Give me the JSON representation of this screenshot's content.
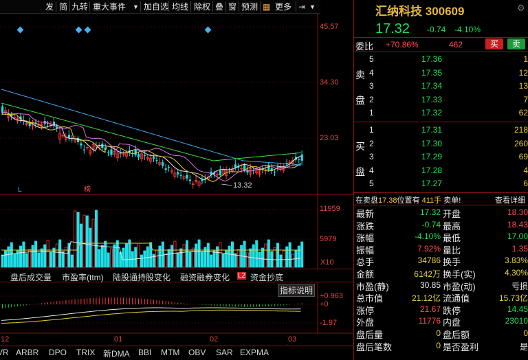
{
  "toolbar": {
    "items": [
      "发",
      "简",
      "九转",
      "重大事件",
      "▼",
      "加自选",
      "均线",
      "除权",
      "叠",
      "窗",
      "预测",
      "更多",
      "▼"
    ]
  },
  "axis": {
    "price": [
      "45.57",
      "34.30",
      "23.03"
    ],
    "volume": [
      "11959",
      "5979",
      "X10"
    ],
    "indicator": [
      "+0.963",
      "+0",
      "-1.97"
    ],
    "dates": [
      "12",
      "01",
      "02",
      "03"
    ]
  },
  "chart_marks": {
    "low_label": "13.32",
    "l1": "L",
    "l2": "榜"
  },
  "tabs": [
    "盘后成交量",
    "市盈率(ttm)",
    "陆股通持股变化",
    "融资融券变化",
    "资金抄底"
  ],
  "tab_l2": "L2",
  "indicator_button": "指标说明",
  "bottom_tabs": [
    "VR",
    "ARBR",
    "DPO",
    "TRIX",
    "新DMA",
    "BBI",
    "MTM",
    "OBV",
    "SAR",
    "EXPMA"
  ],
  "stock": {
    "name": "汇纳科技",
    "code": "300609",
    "price": "17.32",
    "change": "-0.74",
    "change_pct": "-4.10%"
  },
  "weibi": {
    "label": "委比",
    "pct": "+70.86%",
    "diff": "462",
    "sell_btn": "买",
    "buy_btn": "卖"
  },
  "sell_side_label": [
    "卖",
    "盘"
  ],
  "buy_side_label": [
    "买",
    "盘"
  ],
  "asks": [
    {
      "lv": "5",
      "price": "17.36",
      "vol": "1"
    },
    {
      "lv": "4",
      "price": "17.35",
      "vol": "12"
    },
    {
      "lv": "3",
      "price": "17.34",
      "vol": "13"
    },
    {
      "lv": "2",
      "price": "17.33",
      "vol": "7"
    },
    {
      "lv": "1",
      "price": "17.32",
      "vol": "62"
    }
  ],
  "bids": [
    {
      "lv": "1",
      "price": "17.31",
      "vol": "218"
    },
    {
      "lv": "2",
      "price": "17.30",
      "vol": "260"
    },
    {
      "lv": "3",
      "price": "17.29",
      "vol": "69"
    },
    {
      "lv": "4",
      "price": "17.28",
      "vol": "4"
    },
    {
      "lv": "5",
      "price": "17.27",
      "vol": "6"
    }
  ],
  "notice": {
    "text_a": "在卖盘",
    "price": "17.38",
    "text_b": "位置有",
    "qty": "411手",
    "text_c": "卖单!",
    "link": "查看详细"
  },
  "quotes": [
    {
      "l": "最新",
      "v": "17.32",
      "vc": "green",
      "l2": "开盘",
      "v2": "18.30",
      "v2c": "red"
    },
    {
      "l": "涨跌",
      "v": "-0.74",
      "vc": "green",
      "l2": "最高",
      "v2": "18.43",
      "v2c": "red"
    },
    {
      "l": "涨幅",
      "v": "-4.10%",
      "vc": "green",
      "l2": "最低",
      "v2": "17.00",
      "v2c": "green"
    },
    {
      "l": "振幅",
      "v": "7.92%",
      "vc": "red",
      "l2": "量比",
      "v2": "1.35",
      "v2c": "red"
    },
    {
      "l": "总手",
      "v": "34786",
      "vc": "yel",
      "l2": "换手",
      "v2": "3.83%",
      "v2c": "yel"
    },
    {
      "l": "金额",
      "v": "6142万",
      "vc": "yel",
      "l2": "换手(实)",
      "v2": "4.30%",
      "v2c": "yel"
    },
    {
      "l": "市盈(静)",
      "v": "30.85",
      "vc": "white",
      "l2": "市盈(动)",
      "v2": "亏损",
      "v2c": "white"
    },
    {
      "l": "总市值",
      "v": "21.12亿",
      "vc": "yel",
      "l2": "流通值",
      "v2": "15.73亿",
      "v2c": "yel"
    },
    {
      "l": "涨停",
      "v": "21.67",
      "vc": "red",
      "l2": "跌停",
      "v2": "14.45",
      "v2c": "green"
    },
    {
      "l": "外盘",
      "v": "11776",
      "vc": "red",
      "l2": "内盘",
      "v2": "23010",
      "v2c": "green"
    },
    {
      "l": "盘后量",
      "v": "0",
      "vc": "yel",
      "l2": "盘后额",
      "v2": "0",
      "v2c": "yel"
    },
    {
      "l": "盘后笔数",
      "v": "0",
      "vc": "yel",
      "l2": "是否盈利",
      "v2": "是",
      "v2c": "white"
    }
  ],
  "colors": {
    "up": "#ff3b3b",
    "down": "#20e0e8",
    "frame": "#8a1414",
    "ma1": "#e8e8e8",
    "ma2": "#e7d23c",
    "ma3": "#e070e0",
    "ma4": "#40e040",
    "ma5": "#45a8f0"
  }
}
